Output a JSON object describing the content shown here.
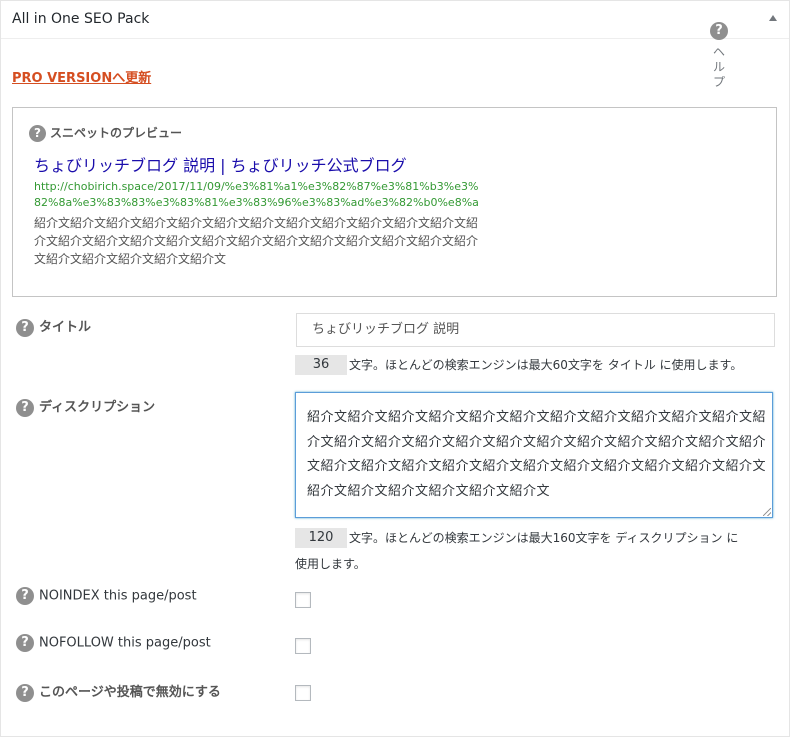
{
  "header": {
    "title": "All in One SEO Pack"
  },
  "help": {
    "icon": "question-icon",
    "label": "ヘルプ"
  },
  "pro_link": "PRO VERSIONへ更新",
  "preview": {
    "label": "スニペットのプレビュー",
    "title": "ちょびリッチブログ 説明 | ちょびリッチ公式ブログ",
    "url": "http://chobirich.space/2017/11/09/%e3%81%a1%e3%82%87%e3%81%b3%e3%82%8a%e3%83%83%e3%83%81%e3%83%96%e3%83%ad%e3%82%b0%e8%aa%ac%e6%98%8e/",
    "description": "紹介文紹介文紹介文紹介文紹介文紹介文紹介文紹介文紹介文紹介文紹介文紹介文紹介文紹介文紹介文紹介文紹介文紹介文紹介文紹介文紹介文紹介文紹介文紹介文紹介文紹介文紹介文紹介文紹介文紹介文"
  },
  "title_field": {
    "label": "タイトル",
    "value": "ちょびリッチブログ 説明",
    "count": "36",
    "count_text": "文字。ほとんどの検索エンジンは最大60文字を タイトル に使用します。"
  },
  "description_field": {
    "label": "ディスクリプション",
    "value": "紹介文紹介文紹介文紹介文紹介文紹介文紹介文紹介文紹介文紹介文紹介文紹介文紹介文紹介文紹介文紹介文紹介文紹介文紹介文紹介文紹介文紹介文紹介文紹介文紹介文紹介文紹介文紹介文紹介文紹介文紹介文紹介文紹介文紹介文紹介文紹介文紹介文紹介文紹介文紹介文",
    "count": "120",
    "count_text_line1": "文字。ほとんどの検索エンジンは最大160文字を ディスクリプション に",
    "count_text_line2": "使用します。"
  },
  "checkboxes": [
    {
      "label": "NOINDEX this page/post",
      "checked": false
    },
    {
      "label": "NOFOLLOW this page/post",
      "checked": false
    },
    {
      "label": "このページや投稿で無効にする",
      "checked": false
    }
  ]
}
